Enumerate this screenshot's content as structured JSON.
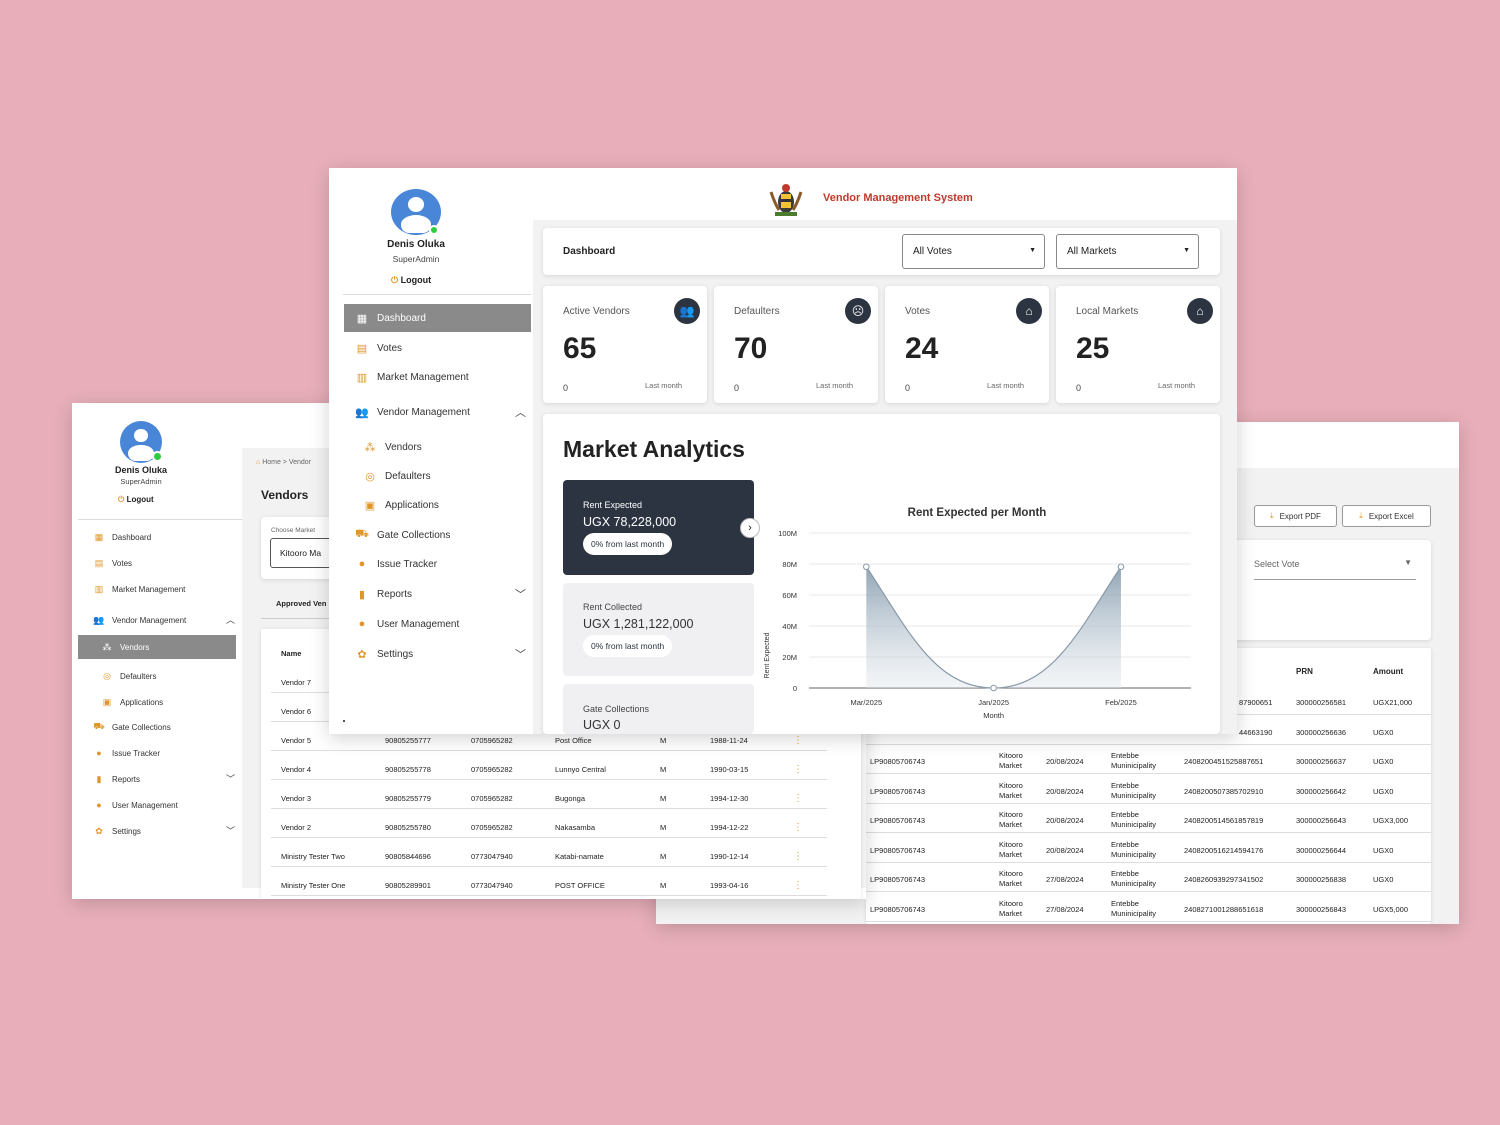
{
  "brand": {
    "title": "Vendor Management System"
  },
  "user": {
    "name": "Denis Oluka",
    "role": "SuperAdmin",
    "logout": "Logout"
  },
  "main": {
    "nav": [
      {
        "label": "Dashboard",
        "icon": "dashboard-icon"
      },
      {
        "label": "Votes",
        "icon": "building-icon"
      },
      {
        "label": "Market Management",
        "icon": "market-icon"
      },
      {
        "label": "Vendor Management",
        "icon": "people-icon"
      },
      {
        "label": "Vendors",
        "icon": "vendors-icon"
      },
      {
        "label": "Defaulters",
        "icon": "defaulters-icon"
      },
      {
        "label": "Applications",
        "icon": "applications-icon"
      },
      {
        "label": "Gate Collections",
        "icon": "truck-icon"
      },
      {
        "label": "Issue Tracker",
        "icon": "info-icon"
      },
      {
        "label": "Reports",
        "icon": "bar-chart-icon"
      },
      {
        "label": "User Management",
        "icon": "user-icon"
      },
      {
        "label": "Settings",
        "icon": "gear-icon"
      }
    ],
    "header": {
      "title": "Dashboard",
      "votes_select": "All Votes",
      "markets_select": "All Markets"
    },
    "stats": [
      {
        "label": "Active Vendors",
        "value": "65",
        "change": "0",
        "period": "Last month",
        "icon": "people-icon"
      },
      {
        "label": "Defaulters",
        "value": "70",
        "change": "0",
        "period": "Last month",
        "icon": "user-x-icon"
      },
      {
        "label": "Votes",
        "value": "24",
        "change": "0",
        "period": "Last month",
        "icon": "home-icon"
      },
      {
        "label": "Local Markets",
        "value": "25",
        "change": "0",
        "period": "Last month",
        "icon": "home-icon"
      }
    ],
    "analytics": {
      "title": "Market Analytics",
      "tiles": [
        {
          "label": "Rent Expected",
          "value": "UGX 78,228,000",
          "change": "0% from last month"
        },
        {
          "label": "Rent Collected",
          "value": "UGX 1,281,122,000",
          "change": "0% from last month"
        },
        {
          "label": "Gate Collections",
          "value": "UGX 0"
        }
      ]
    }
  },
  "chart_data": {
    "type": "area",
    "title": "Rent Expected per Month",
    "xlabel": "Month",
    "ylabel": "Rent Expected",
    "categories": [
      "Mar/2025",
      "Jan/2025",
      "Feb/2025"
    ],
    "values": [
      78228000,
      0,
      78228000
    ],
    "yticks": [
      "0",
      "20M",
      "40M",
      "60M",
      "80M",
      "100M"
    ],
    "ylim": [
      0,
      100000000
    ],
    "grid": true
  },
  "left": {
    "breadcrumb": "Home > Vendor",
    "title": "Vendors",
    "market_label": "Choose Market",
    "market_value": "Kitooro Ma",
    "tab": "Approved Ven",
    "col_name": "Name",
    "nav": [
      {
        "label": "Dashboard",
        "icon": "dashboard-icon"
      },
      {
        "label": "Votes",
        "icon": "building-icon"
      },
      {
        "label": "Market Management",
        "icon": "market-icon"
      },
      {
        "label": "Vendor Management",
        "icon": "people-icon"
      },
      {
        "label": "Vendors",
        "icon": "vendors-icon"
      },
      {
        "label": "Defaulters",
        "icon": "defaulters-icon"
      },
      {
        "label": "Applications",
        "icon": "applications-icon"
      },
      {
        "label": "Gate Collections",
        "icon": "truck-icon"
      },
      {
        "label": "Issue Tracker",
        "icon": "info-icon"
      },
      {
        "label": "Reports",
        "icon": "bar-chart-icon"
      },
      {
        "label": "User Management",
        "icon": "user-icon"
      },
      {
        "label": "Settings",
        "icon": "gear-icon"
      }
    ],
    "rows": [
      {
        "name": "Vendor 7",
        "nin": "",
        "phone": "",
        "market": "",
        "sex": "",
        "dob": ""
      },
      {
        "name": "Vendor 6",
        "nin": "",
        "phone": "",
        "market": "",
        "sex": "",
        "dob": ""
      },
      {
        "name": "Vendor 5",
        "nin": "90805255777",
        "phone": "0705965282",
        "market": "Post Office",
        "sex": "M",
        "dob": "1988-11-24"
      },
      {
        "name": "Vendor 4",
        "nin": "90805255778",
        "phone": "0705965282",
        "market": "Lunnyo Central",
        "sex": "M",
        "dob": "1990-03-15"
      },
      {
        "name": "Vendor 3",
        "nin": "90805255779",
        "phone": "0705965282",
        "market": "Bugonga",
        "sex": "M",
        "dob": "1994-12-30"
      },
      {
        "name": "Vendor 2",
        "nin": "90805255780",
        "phone": "0705965282",
        "market": "Nakasamba",
        "sex": "M",
        "dob": "1994-12-22"
      },
      {
        "name": "Ministry Tester Two",
        "nin": "90805844696",
        "phone": "0773047940",
        "market": "Katabi-namate",
        "sex": "M",
        "dob": "1990-12-14"
      },
      {
        "name": "Ministry Tester One",
        "nin": "90805289901",
        "phone": "0773047940",
        "market": "POST OFFICE",
        "sex": "M",
        "dob": "1993-04-16"
      }
    ]
  },
  "right": {
    "export_pdf": "Export PDF",
    "export_excel": "Export Excel",
    "select_vote": "Select Vote",
    "col_prn": "PRN",
    "col_amount": "Amount",
    "rows": [
      {
        "ref": "",
        "market": "",
        "date": "",
        "vote": "",
        "txn": "87900651",
        "prn": "300000256581",
        "amount": "UGX21,000"
      },
      {
        "ref": "",
        "market": "Market",
        "date": "",
        "vote": "Municipality",
        "txn": "44663190",
        "prn": "300000256636",
        "amount": "UGX0"
      },
      {
        "ref": "LP90805706743",
        "market": "Kitooro Market",
        "date": "20/08/2024",
        "vote": "Entebbe Muninicipality",
        "txn": "240820045152588765​1",
        "prn": "300000256637",
        "amount": "UGX0"
      },
      {
        "ref": "LP90805706743",
        "market": "Kitooro Market",
        "date": "20/08/2024",
        "vote": "Entebbe Muninicipality",
        "txn": "2408200507385702910",
        "prn": "300000256642",
        "amount": "UGX0"
      },
      {
        "ref": "LP90805706743",
        "market": "Kitooro Market",
        "date": "20/08/2024",
        "vote": "Entebbe Muninicipality",
        "txn": "2408200514561857819",
        "prn": "300000256643",
        "amount": "UGX3,000"
      },
      {
        "ref": "LP90805706743",
        "market": "Kitooro Market",
        "date": "20/08/2024",
        "vote": "Entebbe Muninicipality",
        "txn": "2408200516214594176",
        "prn": "300000256644",
        "amount": "UGX0"
      },
      {
        "ref": "LP90805706743",
        "market": "Kitooro Market",
        "date": "27/08/2024",
        "vote": "Entebbe Muninicipality",
        "txn": "2408260939297341502",
        "prn": "300000256838",
        "amount": "UGX0"
      },
      {
        "ref": "LP90805706743",
        "market": "Kitooro Market",
        "date": "27/08/2024",
        "vote": "Entebbe Muninicipality",
        "txn": "2408271001288651618",
        "prn": "300000256843",
        "amount": "UGX5,000"
      }
    ]
  }
}
